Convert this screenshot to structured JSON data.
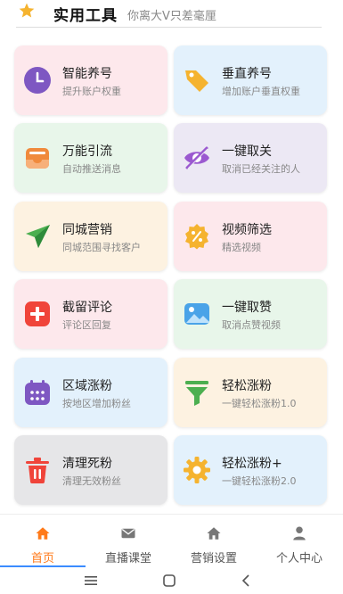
{
  "header": {
    "title": "实用工具",
    "subtitle": "你离大V只差毫厘",
    "star_color": "#f5b32f"
  },
  "cards": [
    {
      "name": "智能养号",
      "desc": "提升账户权重",
      "bg": "#fde8ec",
      "icon": "clock-icon",
      "icon_color": "#7e57c2"
    },
    {
      "name": "垂直养号",
      "desc": "增加账户垂直权重",
      "bg": "#e3f1fc",
      "icon": "tag-icon",
      "icon_color": "#f5b32f"
    },
    {
      "name": "万能引流",
      "desc": "自动推送消息",
      "bg": "#e8f6ea",
      "icon": "inbox-icon",
      "icon_color": "#f08a3c"
    },
    {
      "name": "一键取关",
      "desc": "取消已经关注的人",
      "bg": "#ece8f4",
      "icon": "eye-off-icon",
      "icon_color": "#9b59d0"
    },
    {
      "name": "同城营销",
      "desc": "同城范围寻找客户",
      "bg": "#fdf2e1",
      "icon": "send-icon",
      "icon_color": "#4caf50"
    },
    {
      "name": "视频筛选",
      "desc": "精选视频",
      "bg": "#fde8ec",
      "icon": "discount-icon",
      "icon_color": "#f5b32f"
    },
    {
      "name": "截留评论",
      "desc": "评论区回复",
      "bg": "#fde8ec",
      "icon": "plus-box-icon",
      "icon_color": "#f0443a"
    },
    {
      "name": "一键取赞",
      "desc": "取消点赞视频",
      "bg": "#e8f6ea",
      "icon": "image-icon",
      "icon_color": "#4aa3e8"
    },
    {
      "name": "区域涨粉",
      "desc": "按地区增加粉丝",
      "bg": "#e3f1fc",
      "icon": "calendar-icon",
      "icon_color": "#7e57c2"
    },
    {
      "name": "轻松涨粉",
      "desc": "一键轻松涨粉1.0",
      "bg": "#fdf2e1",
      "icon": "funnel-icon",
      "icon_color": "#4caf50"
    },
    {
      "name": "清理死粉",
      "desc": "清理无效粉丝",
      "bg": "#e6e6e8",
      "icon": "trash-icon",
      "icon_color": "#f0443a"
    },
    {
      "name": "轻松涨粉+",
      "desc": "一键轻松涨粉2.0",
      "bg": "#e3f1fc",
      "icon": "gear-icon",
      "icon_color": "#f5b32f"
    }
  ],
  "tabs": [
    {
      "label": "首页",
      "icon": "home-icon",
      "active": true
    },
    {
      "label": "直播课堂",
      "icon": "mail-icon",
      "active": false
    },
    {
      "label": "营销设置",
      "icon": "home-icon",
      "active": false
    },
    {
      "label": "个人中心",
      "icon": "user-icon",
      "active": false
    }
  ],
  "colors": {
    "accent": "#ff7a1a",
    "tab_underline": "#3b8cff",
    "tab_icon": "#777777"
  }
}
